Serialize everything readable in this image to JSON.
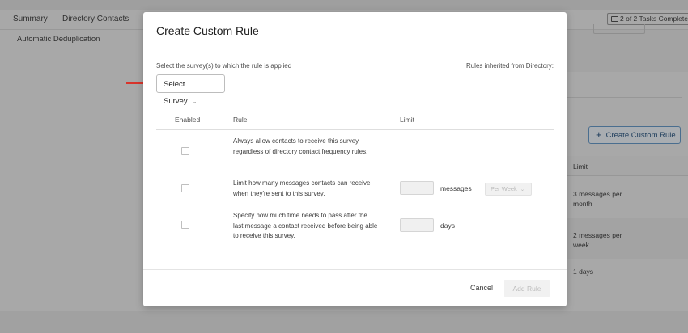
{
  "background": {
    "tabs": [
      "Summary",
      "Directory Contacts"
    ],
    "subnav": "Automatic Deduplication",
    "tasks_label": "2 of 2 Tasks Complete",
    "create_custom_rule_button": "Create Custom Rule",
    "table": {
      "limit_header": "Limit",
      "rows": [
        "3 messages per month",
        "2 messages per week",
        "1 days"
      ]
    }
  },
  "modal": {
    "title": "Create Custom Rule",
    "select_label": "Select the survey(s) to which the rule is applied",
    "inherited_label": "Rules inherited from Directory:",
    "select_button": "Select Survey",
    "columns": {
      "enabled": "Enabled",
      "rule": "Rule",
      "limit": "Limit"
    },
    "rules": [
      {
        "text": "Always allow contacts to receive this survey regardless of directory contact frequency rules.",
        "enabled": false
      },
      {
        "text": "Limit how many messages contacts can receive when they're sent to this survey.",
        "enabled": false,
        "unit": "messages",
        "period": "Per Week"
      },
      {
        "text": "Specify how much time needs to pass after the last message a contact received before being able to receive this survey.",
        "enabled": false,
        "unit": "days"
      }
    ],
    "cancel_label": "Cancel",
    "add_rule_label": "Add Rule"
  },
  "colors": {
    "arrow": "#d9342b",
    "overlay": "#a8a8a8",
    "primary_outline": "#4a6e8f"
  }
}
